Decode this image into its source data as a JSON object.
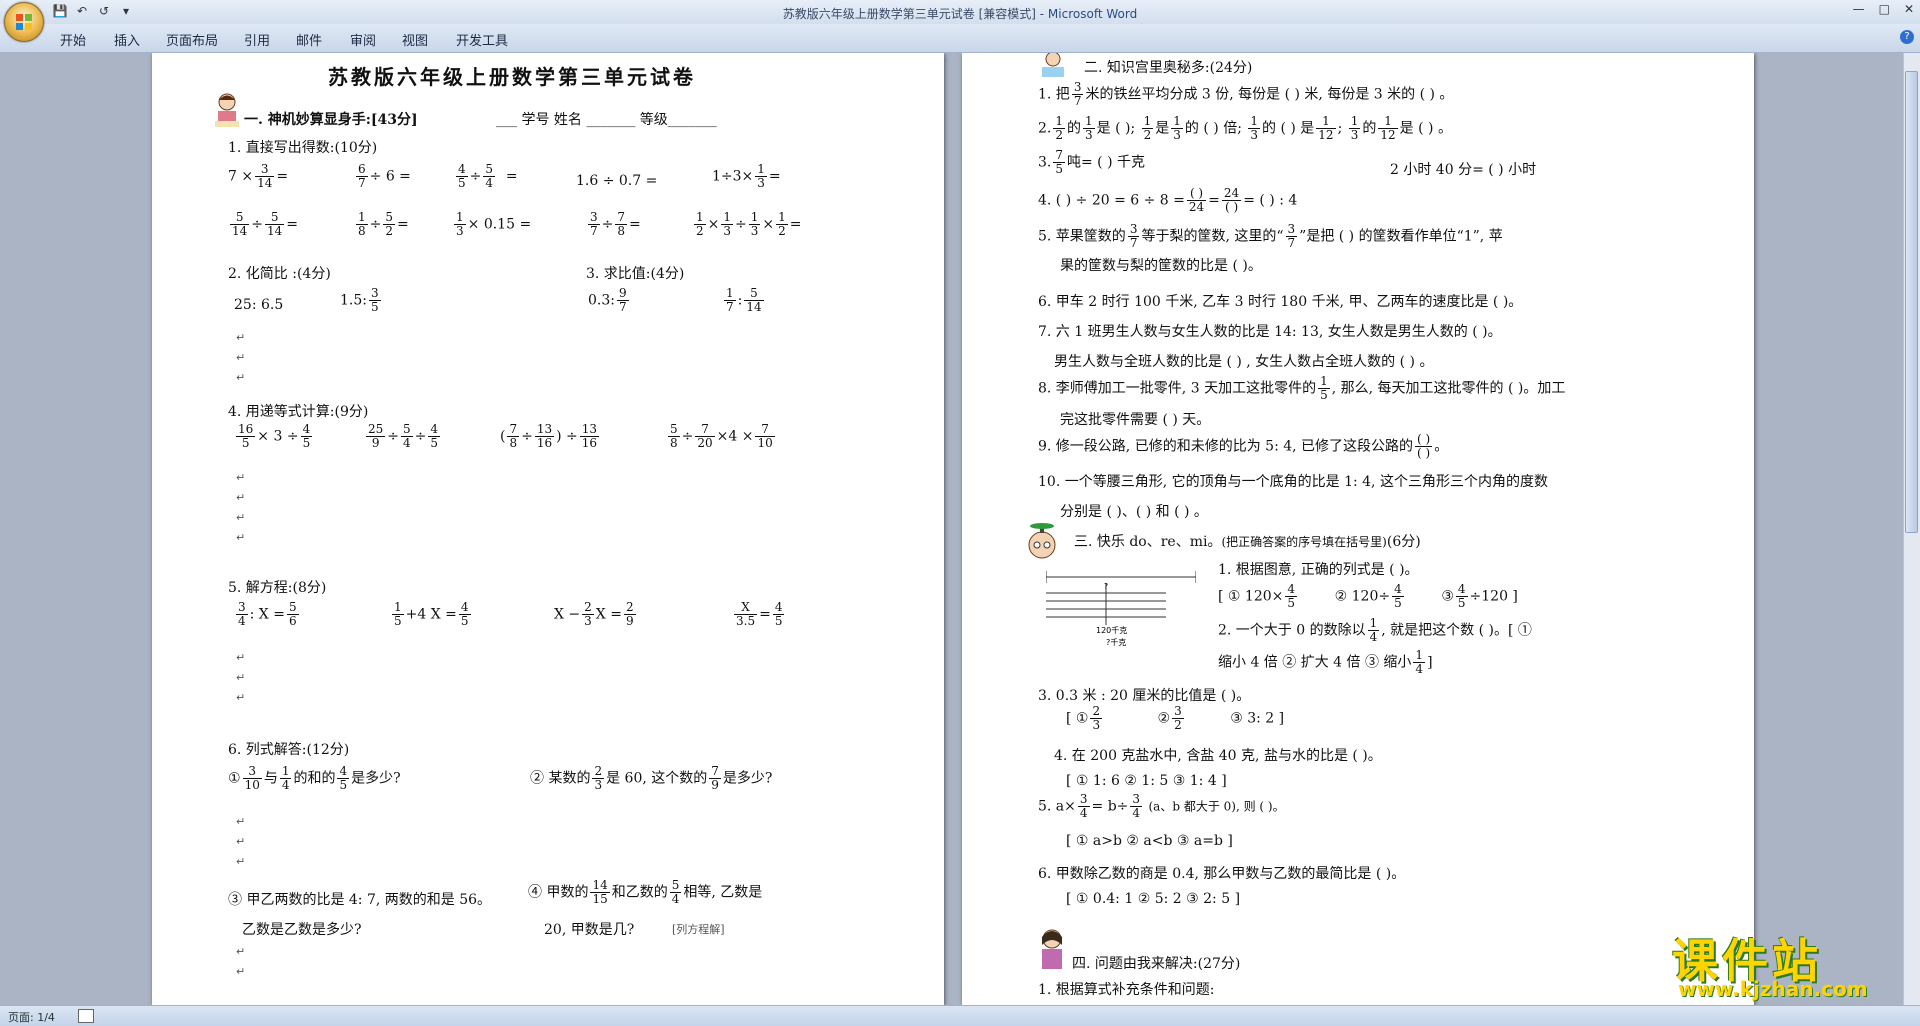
{
  "window": {
    "title": "苏教版六年级上册数学第三单元试卷 [兼容模式] - ",
    "app_name": "Microsoft Word"
  },
  "ribbon_tabs": [
    "开始",
    "插入",
    "页面布局",
    "引用",
    "邮件",
    "审阅",
    "视图",
    "开发工具"
  ],
  "status": {
    "page": "页面: 1/4"
  },
  "watermark": {
    "brand": "课件站",
    "url": "www.kjzhan.com"
  },
  "page1": {
    "title": "苏教版六年级上册数学第三单元试卷",
    "sec1": "一. 神机妙算显身手:[43分]",
    "info": "___ 学号  姓名 _______  等级_______",
    "q1": "1. 直接写出得数:(10分)",
    "q1_items": [
      "7 ×",
      "=",
      "÷ 6 =",
      "÷",
      "=",
      "1.6 ÷ 0.7 =",
      "1÷3×",
      "=",
      "÷",
      "=",
      "÷",
      "=",
      "× 0.15 =",
      "÷",
      "=",
      "×",
      "÷",
      "×",
      "="
    ],
    "q2": "2. 化简比 :(4分)",
    "q2_items": [
      "25: 6.5",
      "1.5:"
    ],
    "q3": "3. 求比值:(4分)",
    "q3_items": [
      "0.3:"
    ],
    "q4": "4. 用递等式计算:(9分)",
    "q5": "5. 解方程:(8分)",
    "q6": "6. 列式解答:(12分)",
    "q6_1a": "①",
    "q6_1b": "与",
    "q6_1c": "的和的",
    "q6_1d": "是多少?",
    "q6_2a": "② 某数的",
    "q6_2b": "是 60, 这个数的",
    "q6_2c": "是多少?",
    "q6_3a": "③ 甲乙两数的比是 4: 7, 两数的和是 56。",
    "q6_3b": "乙数是乙数是多少?",
    "q6_4a": "④ 甲数的",
    "q6_4b": "和乙数的",
    "q6_4c": "相等, 乙数是",
    "q6_4d": "20, 甲数是几?",
    "q6_4e": "[列方程解]"
  },
  "page2": {
    "sec2": "二. 知识宫里奥秘多:(24分)",
    "l1a": "1. 把",
    "l1b": "米的铁丝平均分成 3 份, 每份是 (      ) 米, 每份是 3 米的 (        ) 。",
    "l2a": "2.",
    "l2b": "的",
    "l2c": "是 (  );",
    "l2d": "是",
    "l2e": "的 (  ) 倍;",
    "l2f": "的 (  ) 是",
    "l2g": ";",
    "l2h": "的",
    "l2i": "是 (  ) 。",
    "l3a": "3.",
    "l3b": "吨= (        ) 千克",
    "l3c": "2 小时 40 分= (        ) 小时",
    "l4": "4.  (     ) ÷ 20 = 6 ÷ 8 =",
    "l4b": "= (      ) : 4",
    "l5a": "5. 苹果筐数的",
    "l5b": "等于梨的筐数, 这里的“",
    "l5c": "”是把 (           ) 的筐数看作单位“1”, 苹",
    "l5d": "果的筐数与梨的筐数的比是 (      )。",
    "l6": "6. 甲车 2 时行 100 千米, 乙车 3 时行 180 千米, 甲、乙两车的速度比是 (          )。",
    "l7a": "7. 六 1 班男生人数与女生人数的比是 14: 13, 女生人数是男生人数的 (          )。",
    "l7b": "男生人数与全班人数的比是 (          ) , 女生人数占全班人数的 (       ) 。",
    "l8a": "8. 李师傅加工一批零件, 3 天加工这批零件的",
    "l8b": ", 那么, 每天加工这批零件的 (       )。加工",
    "l8c": "完这批零件需要 (      ) 天。",
    "l9": "9. 修一段公路, 已修的和未修的比为 5: 4, 已修了这段公路的",
    "l10a": "10. 一个等腰三角形, 它的顶角与一个底角的比是 1: 4, 这个三角形三个内角的度数",
    "l10b": "分别是 (       )、(       ) 和 (       ) 。",
    "sec3": "三. 快乐 do、re、mi。",
    "sec3b": "(把正确答案的序号填在括号里)",
    "sec3c": "(6分)",
    "m1": "1. 根据图意, 正确的列式是 (         )。",
    "m1o": "[  ① 120×",
    "m1o2": "② 120÷",
    "m1o3": "③",
    "m1o4": "÷120    ]",
    "m2a": "2. 一个大于 0 的数除以",
    "m2b": ", 就是把这个数 (         )。[   ①",
    "m2c": "缩小 4 倍      ② 扩大 4 倍      ③ 缩小",
    "m3": "3. 0.3 米 : 20 厘米的比值是 (        )。",
    "m3o": "[   ①",
    "m3o2": "②",
    "m3o3": "③ 3: 2    ]",
    "m4": "4. 在 200 克盐水中, 含盐 40 克, 盐与水的比是 (         )。",
    "m4o": "[   ① 1: 6         ② 1: 5         ③ 1: 4    ]",
    "m5a": "5. a×",
    "m5b": "= b÷",
    "m5c": "(a、b 都大于 0), 则 (        )。",
    "m5o": "[  ① a>b         ② a<b        ③ a=b      ]",
    "m6": "6. 甲数除乙数的商是 0.4, 那么甲数与乙数的最简比是 (          )。",
    "m6o": "[   ① 0.4: 1        ②   5: 2        ③   2: 5    ]",
    "sec4": "四. 问题由我来解决:(27分)",
    "p1": "1. 根据算式补充条件和问题:",
    "diag1": "120千克",
    "diag2": "?千克",
    "diag3": "?"
  }
}
